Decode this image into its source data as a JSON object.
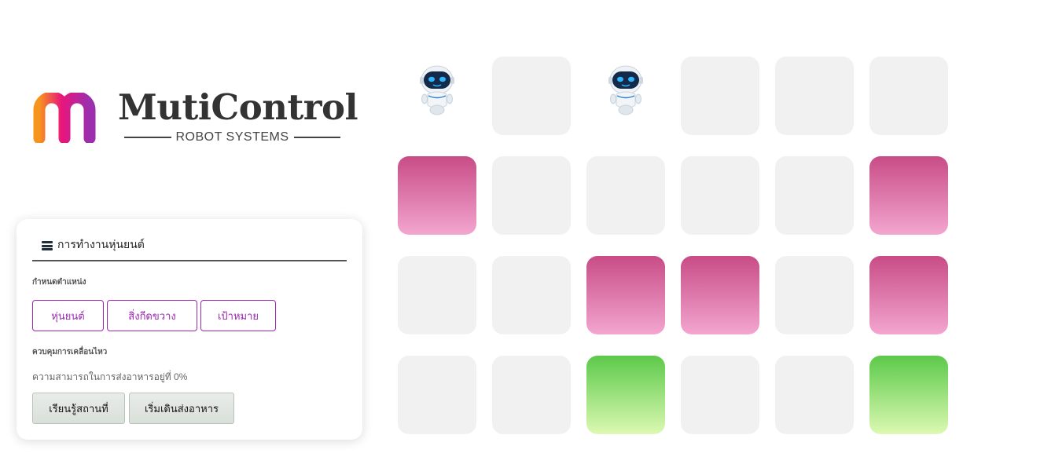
{
  "logo": {
    "name": "MutiControl",
    "tagline": "ROBOT SYSTEMS",
    "colors": [
      "#f7941d",
      "#e8157c",
      "#9b2fae"
    ]
  },
  "panel": {
    "icon": "list-icon",
    "title": "การทำงานหุ่นยนต์",
    "position_label": "กำหนดตำแหน่ง",
    "position_buttons": [
      "หุ่นยนต์",
      "สิ่งกีดขวาง",
      "เป้าหมาย"
    ],
    "motion_label": "ควบคุมการเคลื่อนไหว",
    "status_text": "ความสามารถในการส่งอาหารอยู่ที่ 0%",
    "action_buttons": [
      "เรียนรู้สถานที่",
      "เริ่มเดินส่งอาหาร"
    ]
  },
  "grid": {
    "rows": 4,
    "cols": 6,
    "cells": [
      [
        "robot",
        "empty",
        "robot",
        "empty",
        "empty",
        "empty"
      ],
      [
        "obstacle",
        "empty",
        "empty",
        "empty",
        "empty",
        "obstacle"
      ],
      [
        "empty",
        "empty",
        "obstacle",
        "obstacle",
        "empty",
        "obstacle"
      ],
      [
        "empty",
        "empty",
        "target",
        "empty",
        "empty",
        "target"
      ]
    ],
    "colors": {
      "empty": "#f1f1f1",
      "obstacle": [
        "#c84c86",
        "#f3a6cf"
      ],
      "target": [
        "#5cc94a",
        "#dcf9b2"
      ]
    }
  },
  "accent_color": "#9c27b0"
}
